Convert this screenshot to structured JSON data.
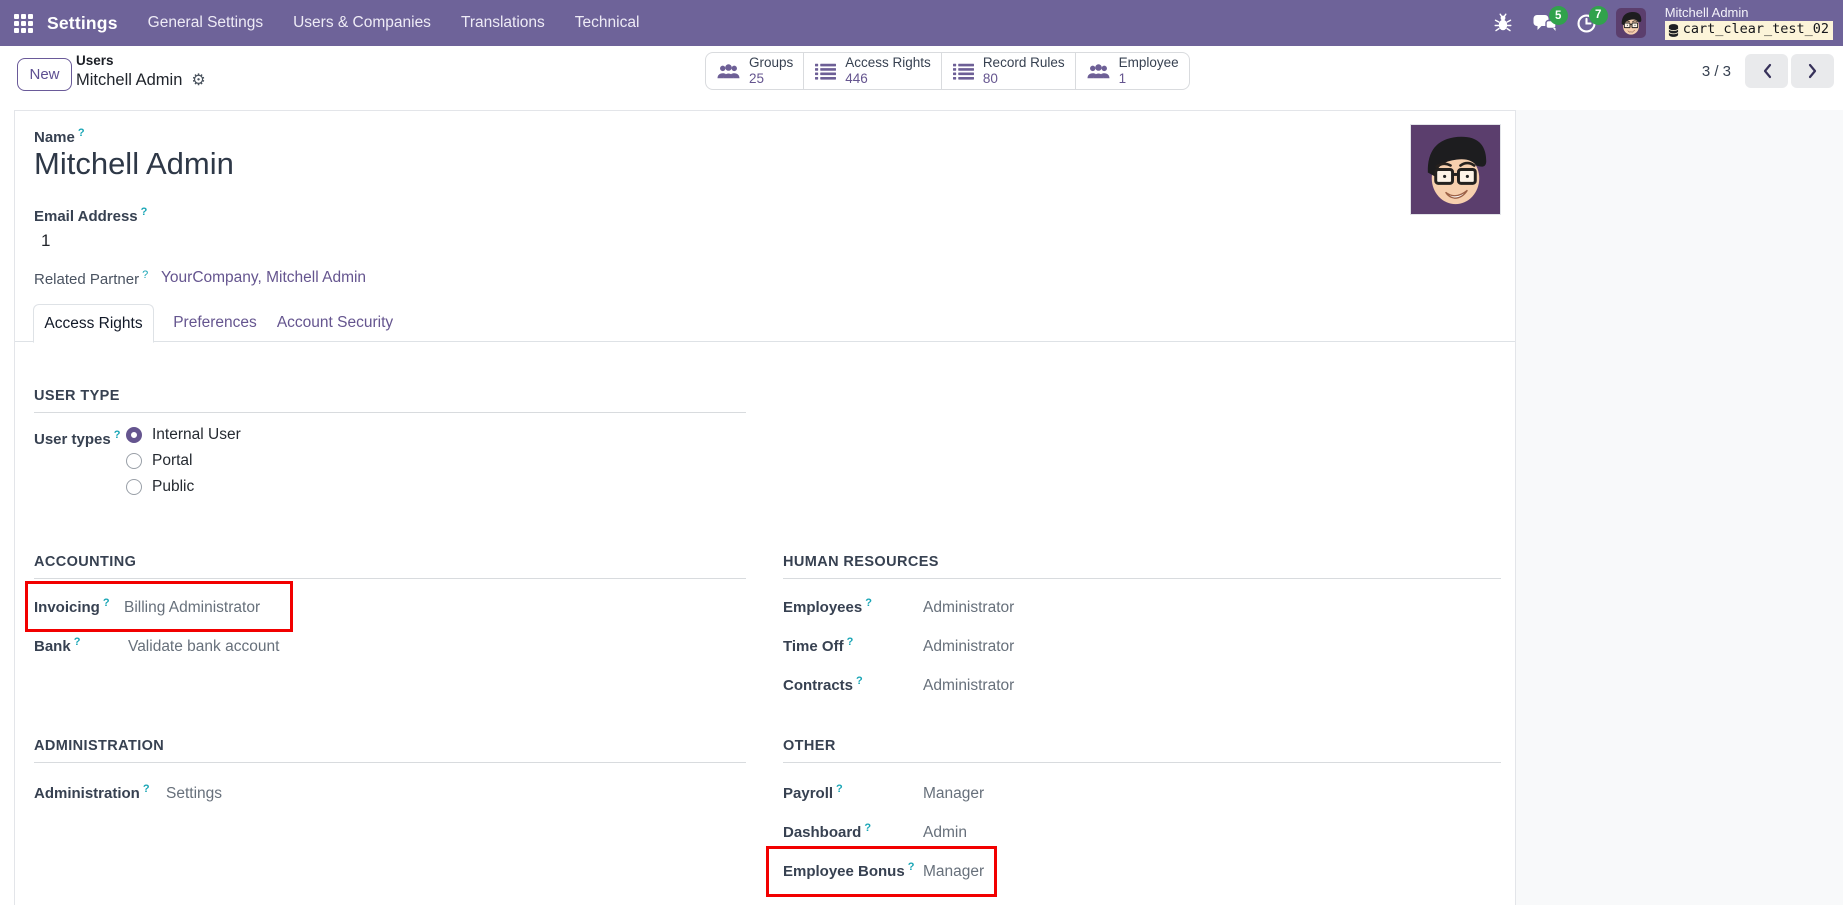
{
  "help": "?",
  "colors": {
    "navbar": "#6e6399",
    "accent": "#65558f",
    "highlight_red": "#f20000",
    "badge_green": "#31a24c",
    "db_badge_bg": "#fcf4d9",
    "help_teal": "#18a5b5"
  },
  "navbar": {
    "app_name": "Settings",
    "menu_items": [
      "General Settings",
      "Users & Companies",
      "Translations",
      "Technical"
    ],
    "messages_badge": "5",
    "activities_badge": "7",
    "user_name": "Mitchell Admin",
    "database": "cart_clear_test_02"
  },
  "control_panel": {
    "new_button": "New",
    "breadcrumb": {
      "parent": "Users",
      "current": "Mitchell Admin"
    },
    "stat_buttons": [
      {
        "label": "Groups",
        "value": "25",
        "icon": "users-icon"
      },
      {
        "label": "Access Rights",
        "value": "446",
        "icon": "list-icon"
      },
      {
        "label": "Record Rules",
        "value": "80",
        "icon": "list-icon"
      },
      {
        "label": "Employee",
        "value": "1",
        "icon": "users-icon"
      }
    ],
    "pager": {
      "text": "3 / 3"
    }
  },
  "form": {
    "name_label": "Name",
    "name_value": "Mitchell Admin",
    "email_label": "Email Address",
    "email_value": "1",
    "partner_label": "Related Partner",
    "partner_value": "YourCompany, Mitchell Admin",
    "tabs": [
      {
        "label": "Access Rights",
        "active": true
      },
      {
        "label": "Preferences",
        "active": false
      },
      {
        "label": "Account Security",
        "active": false
      }
    ],
    "user_type": {
      "section_title": "USER TYPE",
      "field_label": "User types",
      "options": [
        {
          "label": "Internal User",
          "selected": true
        },
        {
          "label": "Portal",
          "selected": false
        },
        {
          "label": "Public",
          "selected": false
        }
      ]
    },
    "sections": {
      "accounting": {
        "title": "ACCOUNTING",
        "fields": [
          {
            "label": "Invoicing",
            "value": "Billing Administrator",
            "highlighted": true
          },
          {
            "label": "Bank",
            "value": "Validate bank account",
            "highlighted": false
          }
        ]
      },
      "human_resources": {
        "title": "HUMAN RESOURCES",
        "fields": [
          {
            "label": "Employees",
            "value": "Administrator"
          },
          {
            "label": "Time Off",
            "value": "Administrator"
          },
          {
            "label": "Contracts",
            "value": "Administrator"
          }
        ]
      },
      "administration": {
        "title": "ADMINISTRATION",
        "fields": [
          {
            "label": "Administration",
            "value": "Settings"
          }
        ]
      },
      "other": {
        "title": "OTHER",
        "fields": [
          {
            "label": "Payroll",
            "value": "Manager"
          },
          {
            "label": "Dashboard",
            "value": "Admin"
          },
          {
            "label": "Employee Bonus",
            "value": "Manager",
            "highlighted": true
          }
        ]
      }
    }
  }
}
